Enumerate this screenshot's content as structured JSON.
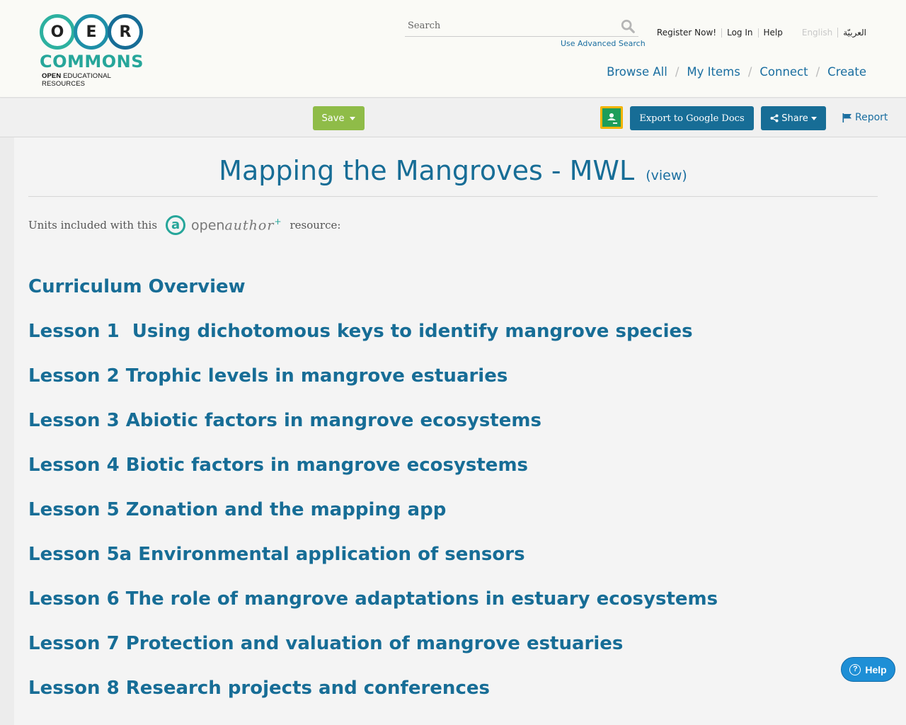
{
  "logo": {
    "letters": [
      "O",
      "E",
      "R"
    ],
    "commons": "COMMONS",
    "tagline_bold": "OPEN",
    "tagline_rest": " EDUCATIONAL RESOURCES"
  },
  "search": {
    "placeholder": "Search",
    "advanced_label": "Use Advanced Search"
  },
  "util_nav": {
    "register": "Register Now!",
    "login": "Log In",
    "help": "Help",
    "lang_english": "English",
    "lang_arabic": "العربيّة"
  },
  "main_nav": {
    "items": [
      "Browse All",
      "My Items",
      "Connect",
      "Create"
    ],
    "separator": "/"
  },
  "toolbar": {
    "save_label": "Save",
    "export_label": "Export to Google Docs",
    "share_label": "Share",
    "report_label": "Report"
  },
  "page": {
    "title": "Mapping the Mangroves - MWL",
    "view_label": "(view)",
    "units_prefix": "Units included with this",
    "units_suffix": "resource:",
    "openauthor_a": "a",
    "openauthor_open": "open",
    "openauthor_author": "author",
    "openauthor_plus": "+"
  },
  "units": [
    "Curriculum Overview",
    "Lesson 1  Using dichotomous keys to identify mangrove species",
    "Lesson 2 Trophic levels in mangrove estuaries",
    "Lesson 3 Abiotic factors in mangrove ecosystems",
    "Lesson 4 Biotic factors in mangrove ecosystems",
    "Lesson 5 Zonation and the mapping app",
    "Lesson 5a Environmental application of sensors",
    "Lesson 6 The role of mangrove adaptations in estuary ecosystems",
    "Lesson 7 Protection and valuation of mangrove estuaries",
    "Lesson 8 Research projects and conferences"
  ],
  "help_widget": {
    "label": "Help",
    "icon_glyph": "?"
  },
  "colors": {
    "brand_blue": "#176d96",
    "brand_teal": "#26a69a",
    "save_green": "#8fbc48",
    "help_blue": "#1e8fd6"
  }
}
